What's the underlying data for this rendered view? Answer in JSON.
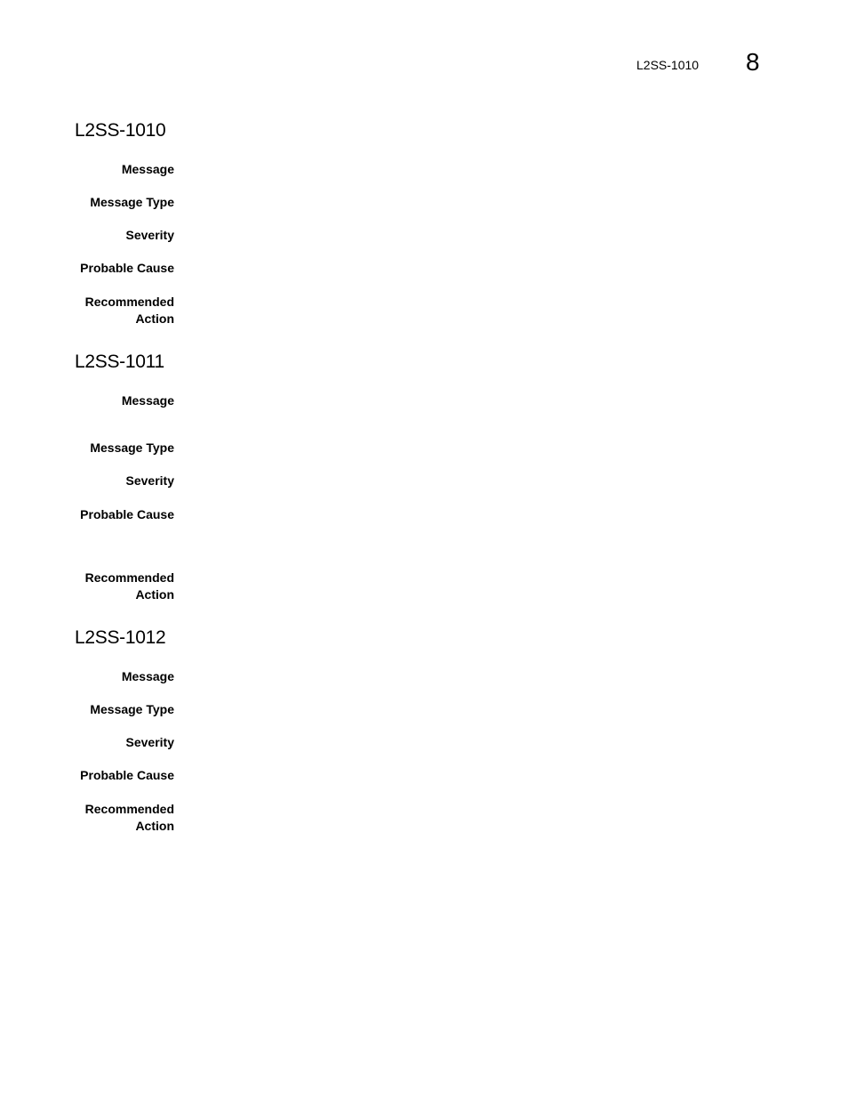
{
  "header": {
    "running_title": "L2SS-1010",
    "chapter_number": "8"
  },
  "sections": [
    {
      "title": "L2SS-1010",
      "fields": [
        {
          "label": "Message",
          "value": ""
        },
        {
          "label": "Message Type",
          "value": ""
        },
        {
          "label": "Severity",
          "value": ""
        },
        {
          "label": "Probable Cause",
          "value": ""
        },
        {
          "label": "Recommended Action",
          "value": ""
        }
      ]
    },
    {
      "title": "L2SS-1011",
      "fields": [
        {
          "label": "Message",
          "value": ""
        },
        {
          "label": "Message Type",
          "value": ""
        },
        {
          "label": "Severity",
          "value": ""
        },
        {
          "label": "Probable Cause",
          "value": ""
        },
        {
          "label": "Recommended Action",
          "value": ""
        }
      ]
    },
    {
      "title": "L2SS-1012",
      "fields": [
        {
          "label": "Message",
          "value": ""
        },
        {
          "label": "Message Type",
          "value": ""
        },
        {
          "label": "Severity",
          "value": ""
        },
        {
          "label": "Probable Cause",
          "value": ""
        },
        {
          "label": "Recommended Action",
          "value": ""
        }
      ]
    }
  ]
}
